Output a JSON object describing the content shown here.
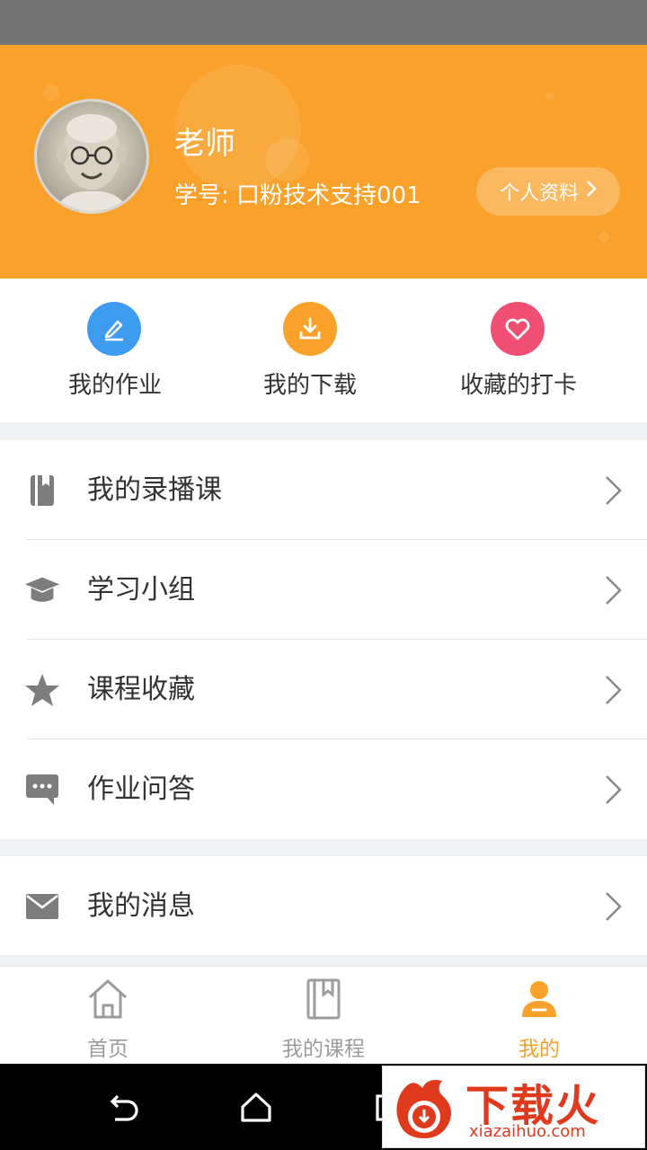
{
  "colors": {
    "accent": "#f9a12a",
    "homework": "#3d9cf0",
    "download": "#f9a12a",
    "favorite": "#ef4f73",
    "text": "#333333",
    "muted": "#9c9c9c"
  },
  "profile": {
    "name": "老师",
    "student_id": "学号: 口粉技术支持001",
    "profile_button": "个人资料"
  },
  "quick_actions": [
    {
      "label": "我的作业",
      "icon": "pencil-icon"
    },
    {
      "label": "我的下载",
      "icon": "download-icon"
    },
    {
      "label": "收藏的打卡",
      "icon": "heart-icon"
    }
  ],
  "menu_group1": [
    {
      "label": "我的录播课",
      "icon": "book-icon"
    },
    {
      "label": "学习小组",
      "icon": "graduation-cap-icon"
    },
    {
      "label": "课程收藏",
      "icon": "star-icon"
    },
    {
      "label": "作业问答",
      "icon": "chat-bubble-icon"
    }
  ],
  "menu_group2": [
    {
      "label": "我的消息",
      "icon": "mail-icon"
    }
  ],
  "tabs": [
    {
      "label": "首页",
      "icon": "home-icon",
      "active": false
    },
    {
      "label": "我的课程",
      "icon": "course-book-icon",
      "active": false
    },
    {
      "label": "我的",
      "icon": "person-icon",
      "active": true
    }
  ],
  "watermark": {
    "title": "下载火",
    "subtitle": "xiazaihuo.com"
  }
}
